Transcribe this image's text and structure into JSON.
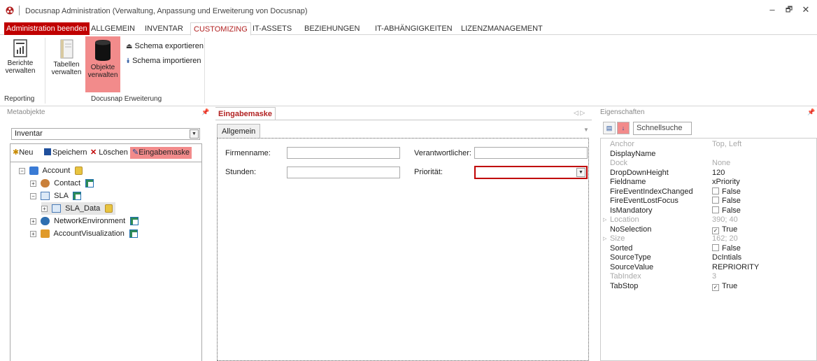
{
  "window": {
    "title": "Docusnap Administration (Verwaltung, Anpassung und Erweiterung von Docusnap)",
    "minimize": "–",
    "maximize": "🗗",
    "close": "✕"
  },
  "menu": {
    "exit": "Administration beenden",
    "tabs": [
      "ALLGEMEIN",
      "INVENTAR",
      "CUSTOMIZING",
      "IT-ASSETS",
      "BEZIEHUNGEN",
      "IT-ABHÄNGIGKEITEN",
      "LIZENZMANAGEMENT"
    ],
    "active_tab": "CUSTOMIZING"
  },
  "ribbon": {
    "reports": {
      "line1": "Berichte",
      "line2": "verwalten"
    },
    "tables": {
      "line1": "Tabellen",
      "line2": "verwalten"
    },
    "objects": {
      "line1": "Objekte",
      "line2": "verwalten"
    },
    "export_schema": "Schema exportieren",
    "import_schema": "Schema importieren",
    "group_reporting": "Reporting",
    "group_extension": "Docusnap Erweiterung"
  },
  "left_panel": {
    "title": "Metaobjekte",
    "select_value": "Inventar",
    "toolbar": {
      "new": "Neu",
      "save": "Speichern",
      "delete": "Löschen",
      "input_mask": "Eingabemaske"
    },
    "tree": [
      {
        "label": "Account",
        "expander": "−"
      },
      {
        "label": "Contact",
        "expander": "+"
      },
      {
        "label": "SLA",
        "expander": "−"
      },
      {
        "label": "SLA_Data",
        "expander": "+"
      },
      {
        "label": "NetworkEnvironment",
        "expander": "+"
      },
      {
        "label": "AccountVisualization",
        "expander": "+"
      }
    ]
  },
  "mid_panel": {
    "doc_tab": "Eingabemaske",
    "nav_arrows": "◁ ▷",
    "tab_label": "Allgemein",
    "fields": {
      "company": "Firmenname:",
      "responsible": "Verantwortlicher:",
      "hours": "Stunden:",
      "priority": "Priorität:"
    }
  },
  "right_panel": {
    "title": "Eigenschaften",
    "search_placeholder": "Schnellsuche",
    "properties": [
      {
        "name": "Anchor",
        "value": "Top, Left",
        "disabled": true
      },
      {
        "name": "DisplayName",
        "value": "",
        "disabled": false
      },
      {
        "name": "Dock",
        "value": "None",
        "disabled": true
      },
      {
        "name": "DropDownHeight",
        "value": "120",
        "disabled": false
      },
      {
        "name": "Fieldname",
        "value": "xPriority",
        "disabled": false
      },
      {
        "name": "FireEventIndexChanged",
        "value": "False",
        "checkbox": true,
        "checked": false
      },
      {
        "name": "FireEventLostFocus",
        "value": "False",
        "checkbox": true,
        "checked": false
      },
      {
        "name": "IsMandatory",
        "value": "False",
        "checkbox": true,
        "checked": false
      },
      {
        "name": "Location",
        "value": "390; 40",
        "disabled": true,
        "expandable": true
      },
      {
        "name": "NoSelection",
        "value": "True",
        "checkbox": true,
        "checked": true
      },
      {
        "name": "Size",
        "value": "162; 20",
        "disabled": true,
        "expandable": true
      },
      {
        "name": "Sorted",
        "value": "False",
        "checkbox": true,
        "checked": false
      },
      {
        "name": "SourceType",
        "value": "DcIntials",
        "disabled": false
      },
      {
        "name": "SourceValue",
        "value": "REPRIORITY",
        "disabled": false
      },
      {
        "name": "TabIndex",
        "value": "3",
        "disabled": true
      },
      {
        "name": "TabStop",
        "value": "True",
        "checkbox": true,
        "checked": true
      }
    ]
  },
  "colors": {
    "accent_red": "#c00000",
    "active_highlight": "#f28b8b"
  }
}
